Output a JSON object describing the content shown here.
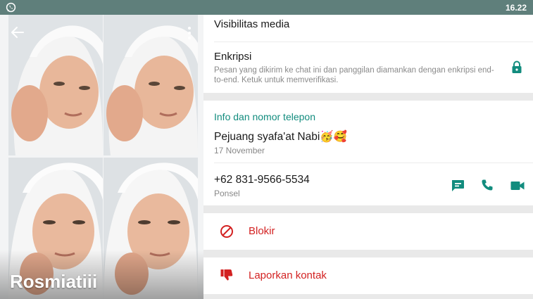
{
  "status_bar": {
    "app_icon": "whatsapp-icon",
    "time": "16.22"
  },
  "profile": {
    "name": "Rosmiatiii",
    "back_icon": "arrow-left-icon",
    "menu_icon": "more-vertical-icon"
  },
  "media": {
    "visibility_label": "Visibilitas media"
  },
  "encryption": {
    "title": "Enkripsi",
    "description": "Pesan yang dikirim ke chat ini dan panggilan diamankan dengan enkripsi end-to-end. Ketuk untuk memverifikasi.",
    "icon": "lock-icon"
  },
  "info": {
    "section_title": "Info dan nomor telepon",
    "about": "Pejuang syafa'at Nabi🥳🥰",
    "about_date": "17 November",
    "phone": "+62 831-9566-5534",
    "phone_type": "Ponsel",
    "actions": [
      {
        "icon": "message-icon"
      },
      {
        "icon": "phone-call-icon"
      },
      {
        "icon": "video-call-icon"
      }
    ]
  },
  "block": {
    "label": "Blokir",
    "icon": "block-icon"
  },
  "report": {
    "label": "Laporkan kontak",
    "icon": "thumbs-down-icon"
  },
  "colors": {
    "accent": "#128c7e",
    "danger": "#d32222",
    "status_bar": "#5f7f7b"
  }
}
